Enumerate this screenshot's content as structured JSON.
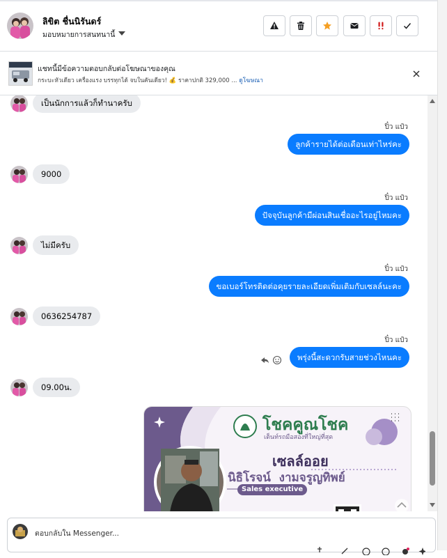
{
  "header": {
    "contact_name": "ลิขิต ชื่นนิรันดร์",
    "assign_label": "มอบหมายการสนทนานี้",
    "actions": [
      {
        "name": "report-spam-button",
        "icon": "warning-icon"
      },
      {
        "name": "delete-button",
        "icon": "trash-icon"
      },
      {
        "name": "star-button",
        "icon": "star-icon",
        "color": "#f59f23"
      },
      {
        "name": "mark-unread-button",
        "icon": "envelope-icon"
      },
      {
        "name": "priority-button",
        "icon": "exclamation-icon",
        "color": "#d11a1a"
      },
      {
        "name": "mark-done-button",
        "icon": "check-icon"
      }
    ]
  },
  "ad_banner": {
    "title": "แชทนี้มีข้อความตอบกลับต่อโฆษณาของคุณ",
    "subtitle": "กระบะหัวเดียว เครื่องแรง บรรทุกได้ จบในคันเดียว! 💰 ราคาปกติ 329,000 ...",
    "link": "ดูโฆษณา"
  },
  "messages": [
    {
      "dir": "in",
      "text": "เป็นนักการแล้วก็ทำนาครับ"
    },
    {
      "dir": "out",
      "meta": "ปิ๋ว แป๋ว",
      "text": "ลูกค้ารายได้ต่อเดือนเท่าไหร่คะ"
    },
    {
      "dir": "in",
      "text": "9000"
    },
    {
      "dir": "out",
      "meta": "ปิ๋ว แป๋ว",
      "text": "ปัจจุบันลูกค้ามีผ่อนสินเชื่ออะไรอยู่ไหมคะ"
    },
    {
      "dir": "in",
      "text": "ไม่มีครับ"
    },
    {
      "dir": "out",
      "meta": "ปิ๋ว แป๋ว",
      "text": "ขอเบอร์โทรติดต่อคุยรายละเอียดเพิ่มเติมกับเซลล์นะคะ"
    },
    {
      "dir": "in",
      "text": "0636254787"
    },
    {
      "dir": "out",
      "meta": "ปิ๋ว แป๋ว",
      "text": "พรุ่งนี้สะดวกรับสายช่วงไหนคะ"
    },
    {
      "dir": "in",
      "text": "09.00น."
    }
  ],
  "sales_card": {
    "brand": "โชคคูณโชค",
    "tagline": "เต็นท์รถมือสองที่ใหญ่ที่สุด",
    "role_thai": "เซลล์ออย",
    "person_name": "นิธิโรจน์  งามจรูญทิพย์",
    "badge": "Sales executive"
  },
  "composer": {
    "placeholder": "ตอบกลับใน Messenger..."
  },
  "colors": {
    "outgoing_bubble": "#0a7cff",
    "incoming_bubble": "#e9ebee",
    "card_purple": "#6c5a8c"
  }
}
